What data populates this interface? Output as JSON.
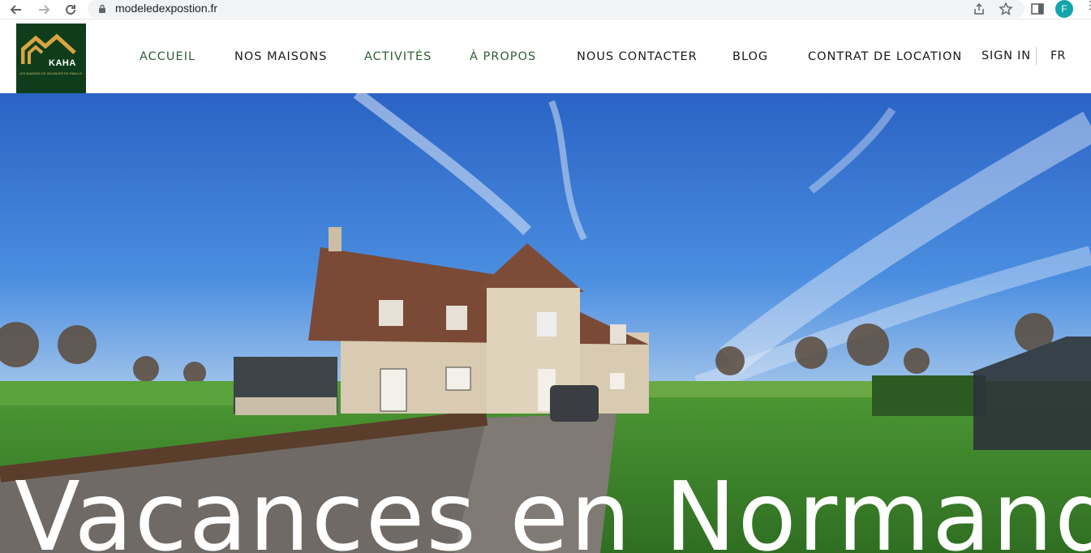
{
  "browser": {
    "url": "modeledexpostion.fr",
    "profile_initial": "F",
    "icons": [
      "back-icon",
      "forward-icon",
      "reload-icon",
      "lock-icon",
      "share-icon",
      "star-icon",
      "sidepanel-icon",
      "menu-icon"
    ]
  },
  "site": {
    "logo_text": "KAHA",
    "logo_tagline": "LES MAISONS DE VACANCES EN FAMILLE",
    "nav": [
      {
        "label": "ACCUEIL",
        "active": true
      },
      {
        "label": "NOS MAISONS",
        "active": false
      },
      {
        "label": "ACTIVITÉS",
        "active": false
      },
      {
        "label": "À PROPOS",
        "active": false
      },
      {
        "label": "NOUS CONTACTER",
        "active": false
      },
      {
        "label": "BLOG",
        "active": false
      },
      {
        "label": "CONTRAT DE LOCATION",
        "active": false
      }
    ],
    "sign_in": "SIGN IN",
    "language": "FR"
  },
  "hero": {
    "title": "Vacances en Normandie"
  },
  "colors": {
    "logo_bg": "#0f3d1c",
    "logo_accent": "#d9a441",
    "nav_green": "#2f5e36",
    "sky": "#2d6fcf",
    "grass": "#3f8a2c"
  }
}
